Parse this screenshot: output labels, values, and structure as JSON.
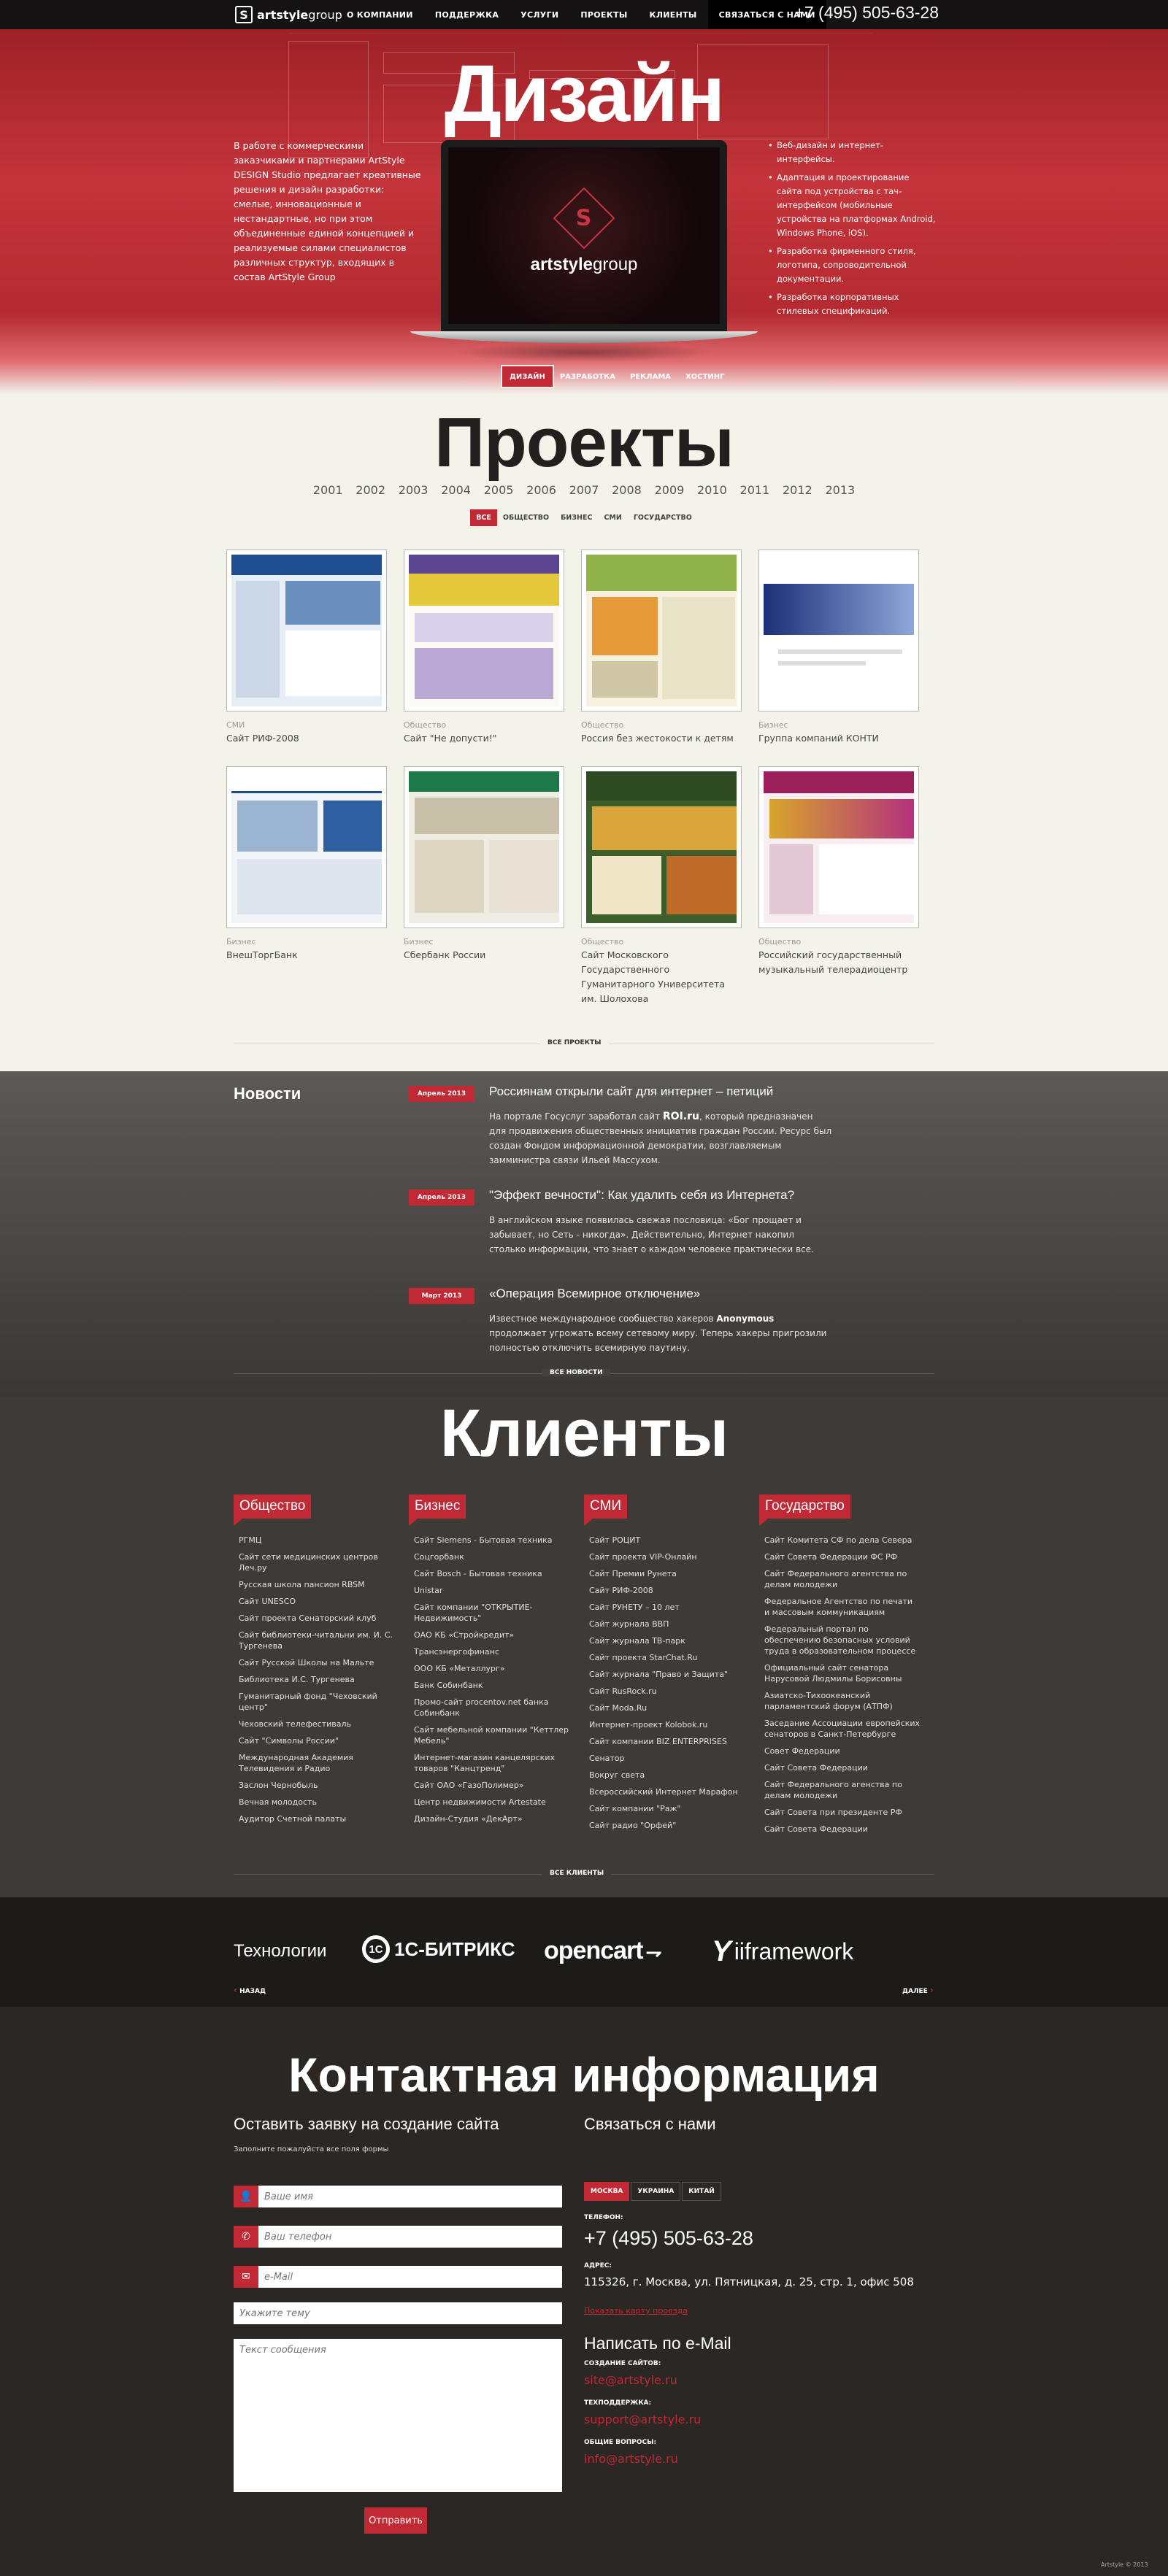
{
  "header": {
    "logo_mark": "S",
    "logo_bold": "artstyle",
    "logo_light": "group",
    "nav": [
      "О КОМПАНИИ",
      "ПОДДЕРЖКА",
      "УСЛУГИ",
      "ПРОЕКТЫ",
      "КЛИЕНТЫ",
      "СВЯЗАТЬСЯ С НАМИ"
    ],
    "phone": "+7 (495) 505-63-28"
  },
  "hero": {
    "title": "Дизайн",
    "intro": "В работе с коммерческими заказчиками и партнерами ArtStyle DESIGN Studio предлагает креативные решения и дизайн разработки: смелые, инновационные и нестандартные, но при этом объединенные единой концепцией и реализуемые силами специалистов различных структур, входящих в состав ArtStyle Group",
    "bullets": [
      "Веб-дизайн и интернет-интерфейсы.",
      "Адаптация и проектирование сайта под устройства с тач-интерфейсом (мобильные устройства на платформах Android, Windows Phone, iOS).",
      "Разработка фирменного стиля, логотипа, сопроводительной документации.",
      "Разработка корпоративных стилевых спецификаций."
    ],
    "screen_brand_bold": "artstyle",
    "screen_brand_light": "group",
    "tabs": [
      "ДИЗАЙН",
      "РАЗРАБОТКА",
      "РЕКЛАМА",
      "ХОСТИНГ"
    ],
    "active_tab": "ДИЗАЙН"
  },
  "projects": {
    "title": "Проекты",
    "years": [
      "2001",
      "2002",
      "2003",
      "2004",
      "2005",
      "2006",
      "2007",
      "2008",
      "2009",
      "2010",
      "2011",
      "2012",
      "2013"
    ],
    "filters": [
      "ВСЕ",
      "ОБЩЕСТВО",
      "БИЗНЕС",
      "СМИ",
      "ГОСУДАРСТВО"
    ],
    "active_filter": "ВСЕ",
    "items": [
      {
        "category": "СМИ",
        "title": "Сайт РИФ-2008"
      },
      {
        "category": "Общество",
        "title": "Сайт \"Не допусти!\""
      },
      {
        "category": "Общество",
        "title": "Россия без жестокости к детям"
      },
      {
        "category": "Бизнес",
        "title": "Группа компаний КОНТИ"
      },
      {
        "category": "Бизнес",
        "title": "ВнешТоргБанк"
      },
      {
        "category": "Бизнес",
        "title": "Сбербанк России"
      },
      {
        "category": "Общество",
        "title": "Сайт Московского Государственного Гуманитарного Университета им. Шолохова"
      },
      {
        "category": "Общество",
        "title": "Российский государственный музыкальный телерадиоцентр"
      }
    ],
    "all_link": "ВСЕ ПРОЕКТЫ"
  },
  "news": {
    "title": "Новости",
    "items": [
      {
        "date": "Апрель 2013",
        "title": "Россиянам открыли сайт для интернет – петиций",
        "body_a": "На портале Госуслуг заработал сайт ",
        "body_b": "ROI.ru",
        "body_c": ", который предназначен для продвижения общественных инициатив граждан России. Ресурс был создан Фондом информационной демократии, возглавляемым замминистра связи Ильей Массухом."
      },
      {
        "date": "Апрель 2013",
        "title": "\"Эффект вечности\": Как удалить себя из Интернета?",
        "body_a": "В английском языке появилась свежая пословица: «Бог прощает и забывает, но Сеть - никогда». Действительно, Интернет накопил столько информации, что знает о каждом человеке практически все.",
        "body_b": "",
        "body_c": ""
      },
      {
        "date": "Март 2013",
        "title": "«Операция Всемирное отключение»",
        "body_a": "Известное международное сообщество хакеров ",
        "body_b": "Anonymous",
        "body_c": " продолжает угрожать всему сетевому миру. Теперь хакеры пригрозили полностью отключить всемирную паутину."
      }
    ],
    "all_link": "ВСЕ НОВОСТИ"
  },
  "clients": {
    "title": "Клиенты",
    "columns": [
      {
        "tag": "Общество",
        "items": [
          "РГМЦ",
          "Сайт сети медицинских центров Леч.ру",
          "Русская школа пансион RBSM",
          "Сайт UNESCO",
          "Сайт проекта Сенаторский клуб",
          "Сайт библиотеки-читальни им. И. С. Тургенева",
          "Сайт Русской Школы на Мальте",
          "Библиотека И.С. Тургенева",
          "Гуманитарный фонд \"Чеховский центр\"",
          "Чеховский телефестиваль",
          "Сайт \"Символы России\"",
          "Международная Академия Телевидения и Радио",
          "Заслон Чернобыль",
          "Вечная молодость",
          "Аудитор Счетной палаты"
        ]
      },
      {
        "tag": "Бизнес",
        "items": [
          "Сайт Siemens - Бытовая техника",
          "Соцгорбанк",
          "Сайт Bosch - Бытовая техника",
          "Unistar",
          "Сайт компании \"ОТКРЫТИЕ-Недвижимость\"",
          "ОАО КБ «Стройкредит»",
          "Трансэнергофинанс",
          "ООО КБ «Металлург»",
          "Банк Собинбанк",
          "Промо-сайт procentov.net банка Собинбанк",
          "Сайт мебельной компании \"Кеттлер Мебель\"",
          "Интернет-магазин канцелярских товаров \"Канцтренд\"",
          "Сайт ОАО «ГазоПолимер»",
          "Центр недвижимости Artestate",
          "Дизайн-Студия «ДекАрт»"
        ]
      },
      {
        "tag": "СМИ",
        "items": [
          "Сайт РОЦИТ",
          "Сайт проекта VIP-Онлайн",
          "Сайт Премии Рунета",
          "Сайт РИФ-2008",
          "Сайт РУНЕТУ – 10 лет",
          "Сайт журнала ВВП",
          "Сайт журнала ТВ-парк",
          "Сайт проекта StarChat.Ru",
          "Сайт журнала \"Право и Защита\"",
          "Сайт RusRock.ru",
          "Сайт Moda.Ru",
          "Интернет-проект Kolobok.ru",
          "Сайт компании BIZ ENTERPRISES",
          "Сенатор",
          "Вокруг света",
          "Всероссийский Интернет Марафон",
          "Сайт компании \"Раж\"",
          "Сайт радио \"Орфей\""
        ]
      },
      {
        "tag": "Государство",
        "items": [
          "Сайт Комитета СФ по дела Севера",
          "Сайт Совета Федерации ФС РФ",
          "Сайт Федерального агентства по делам молодежи",
          "Федеральное Агентство по печати и массовым коммуникациям",
          "Федеральный портал по обеспечению безопасных условий труда в образовательном процессе",
          "Официальный сайт сенатора Нарусовой Людмилы Борисовны",
          "Азиатско-Тихоокеанский парламентский форум (АТПФ)",
          "Заседание Ассоциации европейских сенаторов в Санкт-Петербурге",
          "Совет Федерации",
          "Сайт Совета Федерации",
          "Сайт Федерального агенства по делам молодежи",
          "Сайт Совета при президенте РФ",
          "Сайт Совета Федерации"
        ]
      }
    ],
    "all_link": "ВСЕ КЛИЕНТЫ"
  },
  "tech": {
    "label": "Технологии",
    "bitrix": "1С-БИТРИКС",
    "bitrix_mark": "1С",
    "opencart": "opencart",
    "yii_mark": "Y",
    "yii_text": "iiframework",
    "back": "НАЗАД",
    "next": "ДАЛЕЕ"
  },
  "contacts": {
    "title": "Контактная информация",
    "form_title": "Оставить заявку на создание сайта",
    "form_subtitle": "Заполните пожалуйста все поля формы",
    "name_placeholder": "Ваше имя",
    "phone_placeholder": "Ваш телефон",
    "email_placeholder": "e-Mail",
    "topic_placeholder": "Укажите тему",
    "message_placeholder": "Текст сообщения",
    "submit": "Отправить",
    "contact_title": "Связаться с нами",
    "cities": [
      "МОСКВА",
      "УКРАИНА",
      "КИТАЙ"
    ],
    "active_city": "МОСКВА",
    "phone_label": "ТЕЛЕФОН:",
    "phone": "+7 (495) 505-63-28",
    "address_label": "АДРЕС:",
    "address": "115326, г. Москва, ул. Пятницкая, д. 25, стр. 1, офис 508",
    "map_link": "Показать карту проезда",
    "email_title": "Написать по e-Mail",
    "mail_label_1": "СОЗДАНИЕ САЙТОВ:",
    "mail_1": "site@artstyle.ru",
    "mail_label_2": "ТЕХПОДДЕРЖКА:",
    "mail_2": "support@artstyle.ru",
    "mail_label_3": "ОБЩИЕ ВОПРОСЫ:",
    "mail_3": "info@artstyle.ru",
    "copyright": "Artstyle © 2013"
  },
  "colors": {
    "accent": "#c12a34",
    "hero_red": "#b42a30",
    "dark": "#2b2725",
    "cream": "#f4f3ea"
  }
}
